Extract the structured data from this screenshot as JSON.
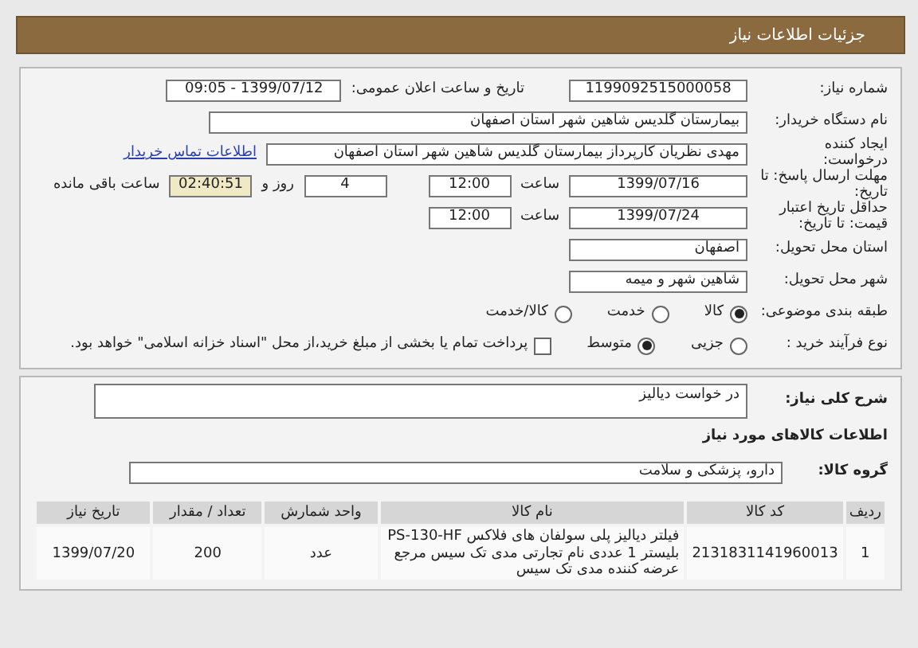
{
  "header": {
    "title": "جزئیات اطلاعات نیاز"
  },
  "need_number": {
    "label": "شماره نیاز:",
    "value": "1199092515000058"
  },
  "announce": {
    "label": "تاریخ و ساعت اعلان عمومی:",
    "value": "1399/07/12 - 09:05"
  },
  "buyer": {
    "label": "نام دستگاه خریدار:",
    "value": "بیمارستان گلدیس شاهین شهر استان اصفهان"
  },
  "creator": {
    "label": "ایجاد کننده درخواست:",
    "value": "مهدی نظریان کارپرداز بیمارستان گلدیس شاهین شهر استان اصفهان",
    "link": "اطلاعات تماس خریدار"
  },
  "reply_deadline": {
    "label": "مهلت ارسال پاسخ: تا تاریخ:",
    "date": "1399/07/16",
    "time_label": "ساعت",
    "time": "12:00",
    "days": "4",
    "days_label": "روز و",
    "remaining": "02:40:51",
    "remaining_label": "ساعت باقی مانده"
  },
  "validity": {
    "label": "حداقل تاریخ اعتبار قیمت: تا تاریخ:",
    "date": "1399/07/24",
    "time_label": "ساعت",
    "time": "12:00"
  },
  "province": {
    "label": "استان محل تحویل:",
    "value": "اصفهان"
  },
  "city": {
    "label": "شهر محل تحویل:",
    "value": "شاهین شهر و میمه"
  },
  "category": {
    "label": "طبقه بندی موضوعی:",
    "options": [
      {
        "label": "کالا",
        "selected": true
      },
      {
        "label": "خدمت",
        "selected": false
      },
      {
        "label": "کالا/خدمت",
        "selected": false
      }
    ]
  },
  "process": {
    "label": "نوع فرآیند خرید :",
    "options": [
      {
        "label": "جزیی",
        "selected": false
      },
      {
        "label": "متوسط",
        "selected": true
      }
    ],
    "payment": {
      "checked": false,
      "text": "پرداخت تمام یا بخشی از مبلغ خرید،از محل \"اسناد خزانه اسلامی\" خواهد بود."
    }
  },
  "description": {
    "label": "شرح کلی نیاز:",
    "value": "در خواست دیالیز"
  },
  "goods_title": "اطلاعات کالاهای مورد نیاز",
  "goods_group": {
    "label": "گروه کالا:",
    "value": "دارو، پزشکی و سلامت"
  },
  "table": {
    "columns": [
      "ردیف",
      "کد کالا",
      "نام کالا",
      "واحد شمارش",
      "تعداد / مقدار",
      "تاریخ نیاز"
    ],
    "rows": [
      {
        "cells": [
          "1",
          "2131831141960013",
          "فیلتر دیالیز پلی سولفان های فلاکس PS-130-HF بلیستر 1 عددی نام تجارتی مدی تک سیس مرجع عرضه کننده مدی تک سیس",
          "عدد",
          "200",
          "1399/07/20"
        ]
      }
    ]
  }
}
